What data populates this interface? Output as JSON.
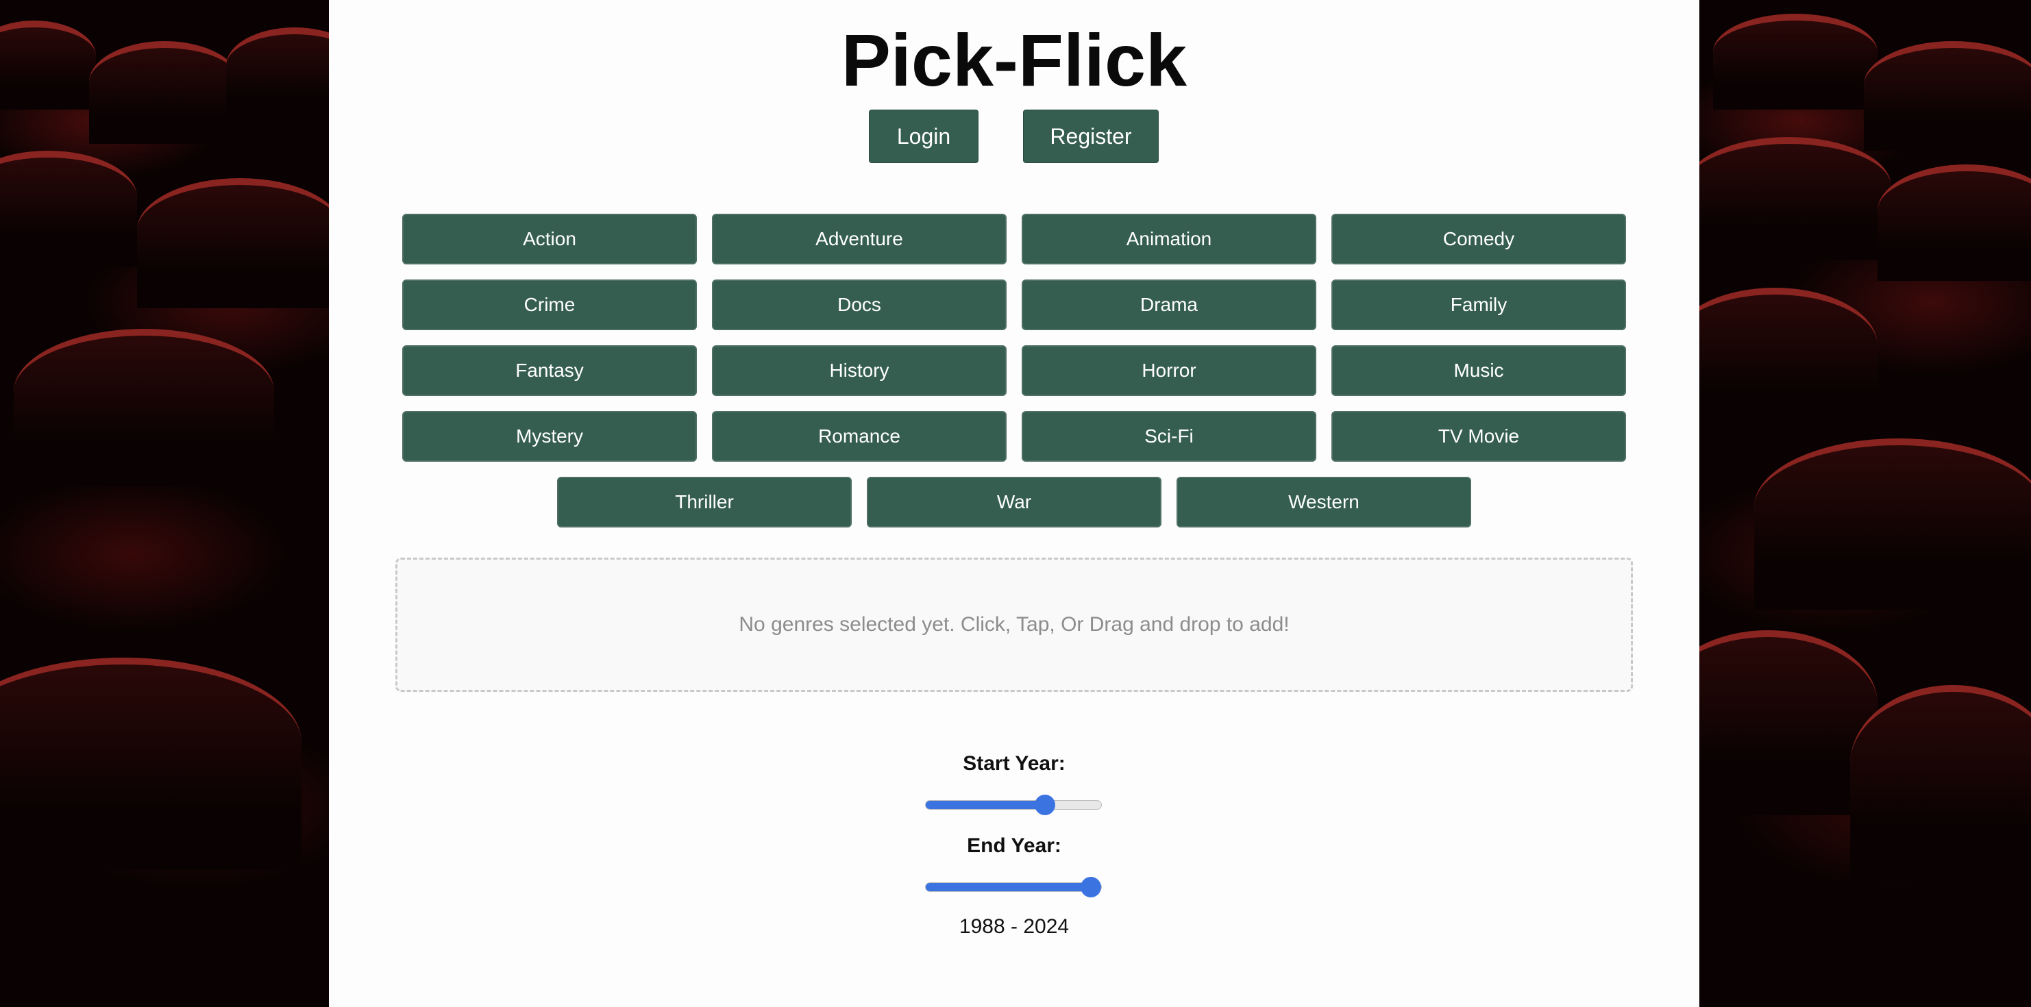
{
  "app": {
    "title": "Pick-Flick"
  },
  "auth": {
    "login_label": "Login",
    "register_label": "Register"
  },
  "genres": [
    "Action",
    "Adventure",
    "Animation",
    "Comedy",
    "Crime",
    "Docs",
    "Drama",
    "Family",
    "Fantasy",
    "History",
    "Horror",
    "Music",
    "Mystery",
    "Romance",
    "Sci-Fi",
    "TV Movie",
    "Thriller",
    "War",
    "Western"
  ],
  "dropzone": {
    "placeholder": "No genres selected yet. Click, Tap, Or Drag and drop to add!"
  },
  "years": {
    "start_label": "Start Year:",
    "end_label": "End Year:",
    "start_fraction": 0.68,
    "end_fraction": 0.94,
    "range_text": "1988 - 2024"
  },
  "colors": {
    "button": "#355e50",
    "slider_accent": "#3b74e0",
    "seat_red": "#8a2420"
  }
}
